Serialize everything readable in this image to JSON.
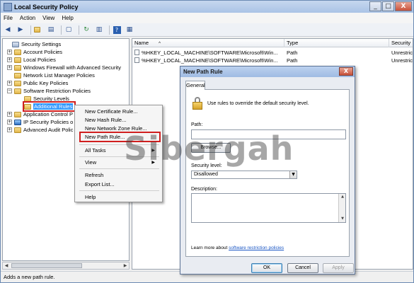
{
  "window": {
    "title": "Local Security Policy",
    "controls": {
      "minimize": "_",
      "maximize": "□",
      "close": "X"
    }
  },
  "menu": [
    "File",
    "Action",
    "View",
    "Help"
  ],
  "tree": {
    "items": [
      {
        "label": "Security Settings",
        "expander": "",
        "icon": "settings-icon"
      },
      {
        "label": "Account Policies",
        "expander": "+",
        "icon": "folder-icon"
      },
      {
        "label": "Local Policies",
        "expander": "+",
        "icon": "folder-icon"
      },
      {
        "label": "Windows Firewall with Advanced Security",
        "expander": "+",
        "icon": "folder-icon"
      },
      {
        "label": "Network List Manager Policies",
        "expander": "",
        "icon": "folder-icon"
      },
      {
        "label": "Public Key Policies",
        "expander": "+",
        "icon": "folder-icon"
      },
      {
        "label": "Software Restriction Policies",
        "expander": "−",
        "icon": "folder-icon"
      },
      {
        "label": "Security Levels",
        "expander": "",
        "icon": "folder-icon"
      },
      {
        "label": "Additional Rules",
        "expander": "",
        "icon": "folder-icon",
        "selected": true
      },
      {
        "label": "Application Control P",
        "expander": "+",
        "icon": "folder-icon"
      },
      {
        "label": "IP Security Policies o",
        "expander": "+",
        "icon": "shield-icon"
      },
      {
        "label": "Advanced Audit Polic",
        "expander": "+",
        "icon": "folder-icon"
      }
    ]
  },
  "list": {
    "columns": [
      "Name",
      "Type",
      "Security"
    ],
    "sort_glyph": "^",
    "rows": [
      {
        "name": "%HKEY_LOCAL_MACHINE\\SOFTWARE\\Microsoft\\Win...",
        "type": "Path",
        "security": "Unrestric"
      },
      {
        "name": "%HKEY_LOCAL_MACHINE\\SOFTWARE\\Microsoft\\Win...",
        "type": "Path",
        "security": "Unrestric"
      }
    ]
  },
  "context_menu": {
    "items": [
      {
        "label": "New Certificate Rule..."
      },
      {
        "label": "New Hash Rule..."
      },
      {
        "label": "New Network Zone Rule..."
      },
      {
        "label": "New Path Rule...",
        "highlighted": true
      },
      {
        "label": "All Tasks",
        "submenu": true
      },
      {
        "label": "View",
        "submenu": true
      },
      {
        "label": "Refresh"
      },
      {
        "label": "Export List..."
      },
      {
        "label": "Help"
      }
    ]
  },
  "watermark": "Sibergah",
  "dialog": {
    "title": "New Path Rule",
    "close": "X",
    "tab": "General",
    "description": "Use rules to override the default security level.",
    "path_label": "Path:",
    "path_value": "",
    "browse_label": "Browse...",
    "security_level_label": "Security level:",
    "security_level_value": "Disallowed",
    "description_label": "Description:",
    "description_value": "",
    "learn_more_prefix": "Learn more about",
    "learn_more_link": "software restriction policies",
    "ok_label": "OK",
    "cancel_label": "Cancel",
    "apply_label": "Apply"
  },
  "status_bar": "Adds a new path rule.",
  "colors": {
    "highlight_red": "#d01e1e",
    "selection_blue": "#3399ff",
    "link_blue": "#1a56c4"
  }
}
